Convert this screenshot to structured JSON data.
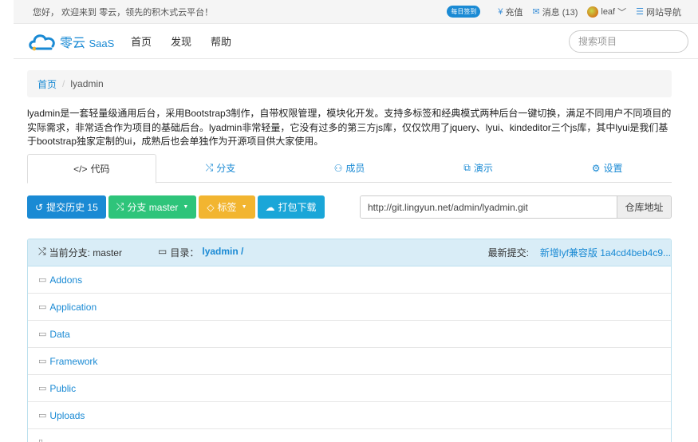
{
  "topbar": {
    "welcome": "您好， 欢迎来到 零云，领先的积木式云平台！",
    "sign_badge": "每日签到",
    "recharge": "充值",
    "messages": "消息 (13)",
    "username": "leaf",
    "site_nav": "网站导航"
  },
  "navbar": {
    "logo_text": "零云",
    "logo_suffix": "SaaS",
    "links": [
      "首页",
      "发现",
      "帮助"
    ],
    "search_placeholder": "搜索项目"
  },
  "breadcrumb": {
    "home": "首页",
    "sep": "/",
    "current": "lyadmin"
  },
  "description": "lyadmin是一套轻量级通用后台，采用Bootstrap3制作，自带权限管理，模块化开发。支持多标签和经典模式两种后台一键切换，满足不同用户不同项目的实际需求，非常适合作为项目的基础后台。lyadmin非常轻量，它没有过多的第三方js库，仅仅饮用了jquery、lyui、kindeditor三个js库，其中lyui是我们基于bootstrap独家定制的ui，成熟后也会单独作为开源项目供大家使用。",
  "tabs": [
    {
      "label": "代码",
      "icon": "code-icon"
    },
    {
      "label": "分支",
      "icon": "branch-icon"
    },
    {
      "label": "成员",
      "icon": "members-icon"
    },
    {
      "label": "演示",
      "icon": "external-link-icon"
    },
    {
      "label": "设置",
      "icon": "gear-icon"
    }
  ],
  "actions": {
    "history": "提交历史 15",
    "branch": "分支 master",
    "tags": "标签",
    "download": "打包下载"
  },
  "repo": {
    "url": "http://git.lingyun.net/admin/lyadmin.git",
    "addon": "仓库地址"
  },
  "filelist": {
    "branch": "当前分支: master",
    "dir_label": "目录：",
    "dir_value": "lyadmin /",
    "commit_label": "最新提交:",
    "commit_msg": "新增lyf兼容版 1a4cd4beb4c9...",
    "files": [
      "Addons",
      "Application",
      "Data",
      "Framework",
      "Public",
      "Uploads"
    ]
  },
  "colors": {
    "primary": "#1a8ad4",
    "green": "#2ec47a",
    "yellow": "#f2b530",
    "cyan": "#1aa6d8",
    "info_bg": "#d9edf7"
  }
}
